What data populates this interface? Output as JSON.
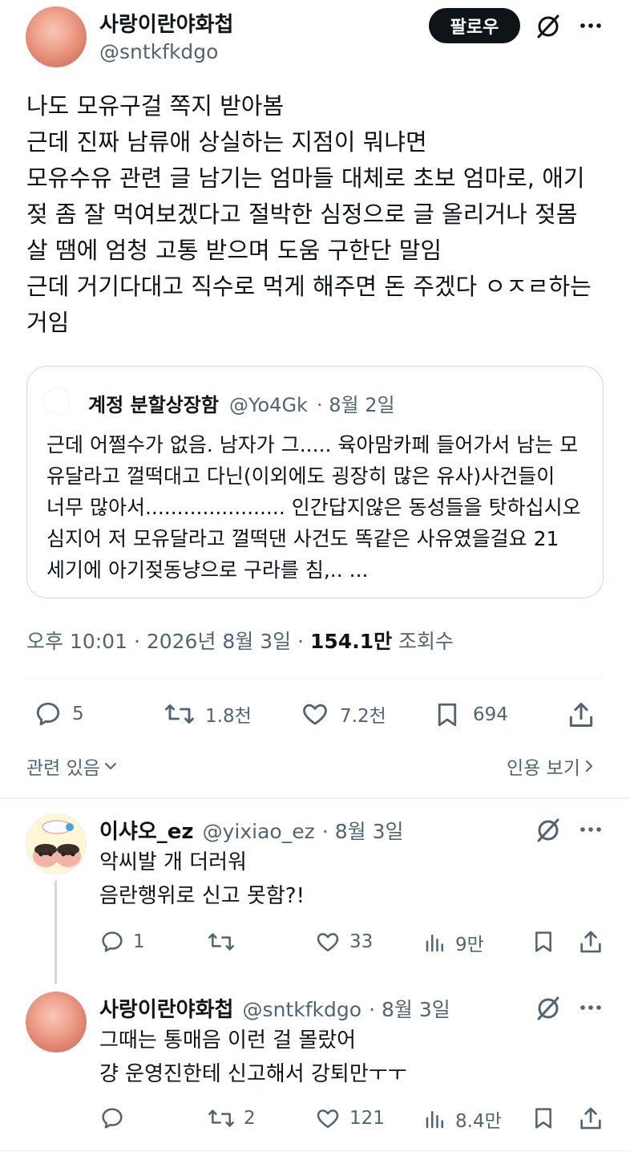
{
  "main_tweet": {
    "author": {
      "name": "사랑이란야화첩",
      "handle": "@sntkfkdgo"
    },
    "follow_label": "팔로우",
    "text_lines": [
      "나도 모유구걸 쪽지 받아봄",
      "근데 진짜 남류애 상실하는 지점이 뭐냐면",
      "모유수유 관련 글 남기는 엄마들 대체로 초보 엄마로, 애기",
      "젖 좀 잘 먹여보겠다고 절박한 심정으로 글 올리거나 젖몸",
      "살 땜에 엄청 고통 받으며 도움 구한단 말임",
      "근데 거기다대고 직수로 먹게 해주면 돈 주겠다 ㅇㅈㄹ하는",
      "거임"
    ],
    "quote": {
      "name": "계정 분할상장함",
      "handle": "@Yo4Gk",
      "date": "· 8월 2일",
      "text_lines": [
        "근데 어쩔수가 없음. 남자가 그..... 육아맘카페 들어가서 남는 모",
        "유달라고 껄떡대고 다닌(이외에도 굉장히 많은 유사)사건들이",
        "너무 많아서...................... 인간답지않은 동성들을 탓하십시오",
        "심지어 저 모유달라고 껄떡댄 사건도 똑같은 사유였을걸요 21",
        "세기에 아기젖동냥으로 구라를 침,.. ..."
      ]
    },
    "timestamp": "오후 10:01 · 2026년 8월 3일 ·",
    "views_count": "154.1만",
    "views_label": "조회수",
    "actions": {
      "replies": "5",
      "retweets": "1.8천",
      "likes": "7.2천",
      "bookmarks": "694"
    },
    "related_label": "관련 있음",
    "quotes_label": "인용 보기"
  },
  "replies": [
    {
      "name": "이샤오_ez",
      "handle": "@yixiao_ez",
      "date": "· 8월 3일",
      "text_lines": [
        "악씨발 개 더러워",
        "음란행위로 신고 못함?!"
      ],
      "actions": {
        "replies": "1",
        "retweets": "",
        "likes": "33",
        "views": "9만"
      }
    },
    {
      "name": "사랑이란야화첩",
      "handle": "@sntkfkdgo",
      "date": "· 8월 3일",
      "text_lines": [
        "그때는 통매음 이런 걸 몰랐어",
        "걍 운영진한테 신고해서 강퇴만ㅜㅜ"
      ],
      "actions": {
        "replies": "",
        "retweets": "2",
        "likes": "121",
        "views": "8.4만"
      }
    }
  ],
  "colors": {
    "text": "#0f1419",
    "secondary": "#536471",
    "border": "#cfd9de",
    "divider": "#eff3f4"
  }
}
